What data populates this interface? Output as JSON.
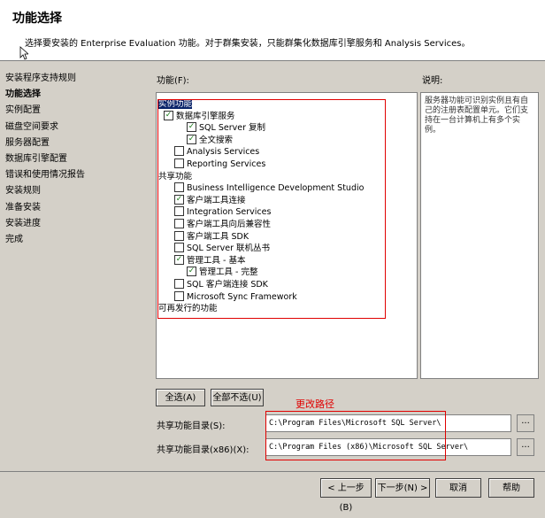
{
  "page": {
    "title": "功能选择",
    "description": "选择要安装的 Enterprise Evaluation 功能。对于群集安装，只能群集化数据库引擎服务和 Analysis Services。"
  },
  "nav": {
    "items": [
      {
        "label": "安装程序支持规则"
      },
      {
        "label": "功能选择"
      },
      {
        "label": "实例配置"
      },
      {
        "label": "磁盘空间要求"
      },
      {
        "label": "服务器配置"
      },
      {
        "label": "数据库引擎配置"
      },
      {
        "label": "错误和使用情况报告"
      },
      {
        "label": "安装规则"
      },
      {
        "label": "准备安装"
      },
      {
        "label": "安装进度"
      },
      {
        "label": "完成"
      }
    ]
  },
  "features": {
    "label": "功能(F):",
    "tree": [
      {
        "label": "实例功能",
        "checkbox": false,
        "checked": false,
        "selected": true
      },
      {
        "label": "数据库引擎服务",
        "checkbox": true,
        "checked": true
      },
      {
        "label": "SQL Server 复制",
        "checkbox": true,
        "checked": true
      },
      {
        "label": "全文搜索",
        "checkbox": true,
        "checked": true
      },
      {
        "label": "Analysis Services",
        "checkbox": true,
        "checked": false
      },
      {
        "label": "Reporting Services",
        "checkbox": true,
        "checked": false
      },
      {
        "label": "共享功能",
        "checkbox": false,
        "checked": false
      },
      {
        "label": "Business Intelligence Development Studio",
        "checkbox": true,
        "checked": false
      },
      {
        "label": "客户端工具连接",
        "checkbox": true,
        "checked": true
      },
      {
        "label": "Integration Services",
        "checkbox": true,
        "checked": false
      },
      {
        "label": "客户端工具向后兼容性",
        "checkbox": true,
        "checked": false
      },
      {
        "label": "客户端工具 SDK",
        "checkbox": true,
        "checked": false
      },
      {
        "label": "SQL Server 联机丛书",
        "checkbox": true,
        "checked": false
      },
      {
        "label": "管理工具 - 基本",
        "checkbox": true,
        "checked": true
      },
      {
        "label": "管理工具 - 完整",
        "checkbox": true,
        "checked": true
      },
      {
        "label": "SQL 客户端连接 SDK",
        "checkbox": true,
        "checked": false
      },
      {
        "label": "Microsoft Sync Framework",
        "checkbox": true,
        "checked": false
      },
      {
        "label": "可再发行的功能",
        "checkbox": false,
        "checked": false
      }
    ]
  },
  "description_panel": {
    "label": "说明:",
    "text": "服务器功能可识别实例且有自己的注册表配置单元。它们支持在一台计算机上有多个实例。"
  },
  "buttons": {
    "select_all": "全选(A)",
    "unselect_all": "全部不选(U)",
    "back": "< 上一步(B)",
    "next": "下一步(N) >",
    "cancel": "取消",
    "help": "帮助",
    "browse": "..."
  },
  "paths": {
    "annotation": "更改路径",
    "shared_label": "共享功能目录(S):",
    "shared_value": "C:\\Program Files\\Microsoft SQL Server\\",
    "shared_x86_label": "共享功能目录(x86)(X):",
    "shared_x86_value": "C:\\Program Files (x86)\\Microsoft SQL Server\\"
  },
  "colors": {
    "highlight_box": "#e00000",
    "check": "#1a7a1a",
    "selection": "#0a246a"
  }
}
